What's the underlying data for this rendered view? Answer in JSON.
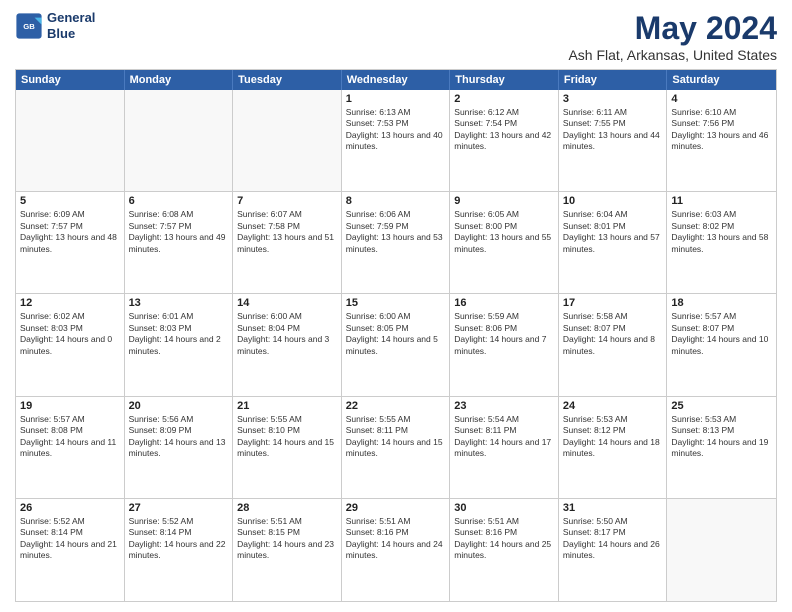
{
  "header": {
    "logo": {
      "line1": "General",
      "line2": "Blue"
    },
    "month": "May 2024",
    "location": "Ash Flat, Arkansas, United States"
  },
  "weekdays": [
    "Sunday",
    "Monday",
    "Tuesday",
    "Wednesday",
    "Thursday",
    "Friday",
    "Saturday"
  ],
  "weeks": [
    [
      {
        "day": "",
        "sunrise": "",
        "sunset": "",
        "daylight": "",
        "empty": true
      },
      {
        "day": "",
        "sunrise": "",
        "sunset": "",
        "daylight": "",
        "empty": true
      },
      {
        "day": "",
        "sunrise": "",
        "sunset": "",
        "daylight": "",
        "empty": true
      },
      {
        "day": "1",
        "sunrise": "Sunrise: 6:13 AM",
        "sunset": "Sunset: 7:53 PM",
        "daylight": "Daylight: 13 hours and 40 minutes.",
        "empty": false
      },
      {
        "day": "2",
        "sunrise": "Sunrise: 6:12 AM",
        "sunset": "Sunset: 7:54 PM",
        "daylight": "Daylight: 13 hours and 42 minutes.",
        "empty": false
      },
      {
        "day": "3",
        "sunrise": "Sunrise: 6:11 AM",
        "sunset": "Sunset: 7:55 PM",
        "daylight": "Daylight: 13 hours and 44 minutes.",
        "empty": false
      },
      {
        "day": "4",
        "sunrise": "Sunrise: 6:10 AM",
        "sunset": "Sunset: 7:56 PM",
        "daylight": "Daylight: 13 hours and 46 minutes.",
        "empty": false
      }
    ],
    [
      {
        "day": "5",
        "sunrise": "Sunrise: 6:09 AM",
        "sunset": "Sunset: 7:57 PM",
        "daylight": "Daylight: 13 hours and 48 minutes.",
        "empty": false
      },
      {
        "day": "6",
        "sunrise": "Sunrise: 6:08 AM",
        "sunset": "Sunset: 7:57 PM",
        "daylight": "Daylight: 13 hours and 49 minutes.",
        "empty": false
      },
      {
        "day": "7",
        "sunrise": "Sunrise: 6:07 AM",
        "sunset": "Sunset: 7:58 PM",
        "daylight": "Daylight: 13 hours and 51 minutes.",
        "empty": false
      },
      {
        "day": "8",
        "sunrise": "Sunrise: 6:06 AM",
        "sunset": "Sunset: 7:59 PM",
        "daylight": "Daylight: 13 hours and 53 minutes.",
        "empty": false
      },
      {
        "day": "9",
        "sunrise": "Sunrise: 6:05 AM",
        "sunset": "Sunset: 8:00 PM",
        "daylight": "Daylight: 13 hours and 55 minutes.",
        "empty": false
      },
      {
        "day": "10",
        "sunrise": "Sunrise: 6:04 AM",
        "sunset": "Sunset: 8:01 PM",
        "daylight": "Daylight: 13 hours and 57 minutes.",
        "empty": false
      },
      {
        "day": "11",
        "sunrise": "Sunrise: 6:03 AM",
        "sunset": "Sunset: 8:02 PM",
        "daylight": "Daylight: 13 hours and 58 minutes.",
        "empty": false
      }
    ],
    [
      {
        "day": "12",
        "sunrise": "Sunrise: 6:02 AM",
        "sunset": "Sunset: 8:03 PM",
        "daylight": "Daylight: 14 hours and 0 minutes.",
        "empty": false
      },
      {
        "day": "13",
        "sunrise": "Sunrise: 6:01 AM",
        "sunset": "Sunset: 8:03 PM",
        "daylight": "Daylight: 14 hours and 2 minutes.",
        "empty": false
      },
      {
        "day": "14",
        "sunrise": "Sunrise: 6:00 AM",
        "sunset": "Sunset: 8:04 PM",
        "daylight": "Daylight: 14 hours and 3 minutes.",
        "empty": false
      },
      {
        "day": "15",
        "sunrise": "Sunrise: 6:00 AM",
        "sunset": "Sunset: 8:05 PM",
        "daylight": "Daylight: 14 hours and 5 minutes.",
        "empty": false
      },
      {
        "day": "16",
        "sunrise": "Sunrise: 5:59 AM",
        "sunset": "Sunset: 8:06 PM",
        "daylight": "Daylight: 14 hours and 7 minutes.",
        "empty": false
      },
      {
        "day": "17",
        "sunrise": "Sunrise: 5:58 AM",
        "sunset": "Sunset: 8:07 PM",
        "daylight": "Daylight: 14 hours and 8 minutes.",
        "empty": false
      },
      {
        "day": "18",
        "sunrise": "Sunrise: 5:57 AM",
        "sunset": "Sunset: 8:07 PM",
        "daylight": "Daylight: 14 hours and 10 minutes.",
        "empty": false
      }
    ],
    [
      {
        "day": "19",
        "sunrise": "Sunrise: 5:57 AM",
        "sunset": "Sunset: 8:08 PM",
        "daylight": "Daylight: 14 hours and 11 minutes.",
        "empty": false
      },
      {
        "day": "20",
        "sunrise": "Sunrise: 5:56 AM",
        "sunset": "Sunset: 8:09 PM",
        "daylight": "Daylight: 14 hours and 13 minutes.",
        "empty": false
      },
      {
        "day": "21",
        "sunrise": "Sunrise: 5:55 AM",
        "sunset": "Sunset: 8:10 PM",
        "daylight": "Daylight: 14 hours and 15 minutes.",
        "empty": false
      },
      {
        "day": "22",
        "sunrise": "Sunrise: 5:55 AM",
        "sunset": "Sunset: 8:11 PM",
        "daylight": "Daylight: 14 hours and 15 minutes.",
        "empty": false
      },
      {
        "day": "23",
        "sunrise": "Sunrise: 5:54 AM",
        "sunset": "Sunset: 8:11 PM",
        "daylight": "Daylight: 14 hours and 17 minutes.",
        "empty": false
      },
      {
        "day": "24",
        "sunrise": "Sunrise: 5:53 AM",
        "sunset": "Sunset: 8:12 PM",
        "daylight": "Daylight: 14 hours and 18 minutes.",
        "empty": false
      },
      {
        "day": "25",
        "sunrise": "Sunrise: 5:53 AM",
        "sunset": "Sunset: 8:13 PM",
        "daylight": "Daylight: 14 hours and 19 minutes.",
        "empty": false
      }
    ],
    [
      {
        "day": "26",
        "sunrise": "Sunrise: 5:52 AM",
        "sunset": "Sunset: 8:14 PM",
        "daylight": "Daylight: 14 hours and 21 minutes.",
        "empty": false
      },
      {
        "day": "27",
        "sunrise": "Sunrise: 5:52 AM",
        "sunset": "Sunset: 8:14 PM",
        "daylight": "Daylight: 14 hours and 22 minutes.",
        "empty": false
      },
      {
        "day": "28",
        "sunrise": "Sunrise: 5:51 AM",
        "sunset": "Sunset: 8:15 PM",
        "daylight": "Daylight: 14 hours and 23 minutes.",
        "empty": false
      },
      {
        "day": "29",
        "sunrise": "Sunrise: 5:51 AM",
        "sunset": "Sunset: 8:16 PM",
        "daylight": "Daylight: 14 hours and 24 minutes.",
        "empty": false
      },
      {
        "day": "30",
        "sunrise": "Sunrise: 5:51 AM",
        "sunset": "Sunset: 8:16 PM",
        "daylight": "Daylight: 14 hours and 25 minutes.",
        "empty": false
      },
      {
        "day": "31",
        "sunrise": "Sunrise: 5:50 AM",
        "sunset": "Sunset: 8:17 PM",
        "daylight": "Daylight: 14 hours and 26 minutes.",
        "empty": false
      },
      {
        "day": "",
        "sunrise": "",
        "sunset": "",
        "daylight": "",
        "empty": true
      }
    ]
  ]
}
